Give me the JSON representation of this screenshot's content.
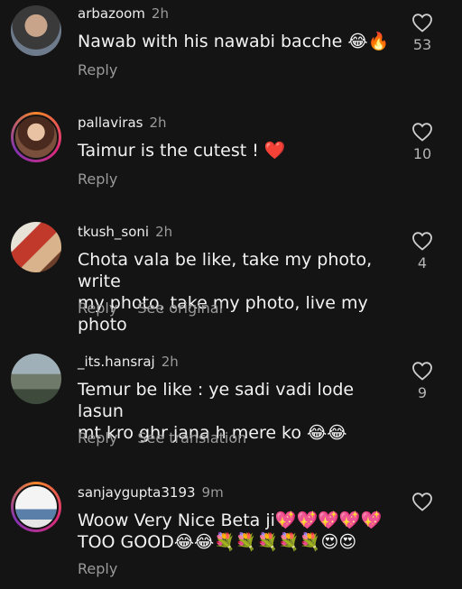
{
  "comments": [
    {
      "username": "arbazoom",
      "time": "2h",
      "lines": [
        "Nawab with his nawabi bacche 😂🔥"
      ],
      "likes": "53",
      "actions": [
        "Reply"
      ]
    },
    {
      "username": "pallaviras",
      "time": "2h",
      "lines": [
        "Taimur is the cutest ! ❤️"
      ],
      "likes": "10",
      "actions": [
        "Reply"
      ]
    },
    {
      "username": "tkush_soni",
      "time": "2h",
      "lines": [
        "Chota vala be like, take my photo, write",
        "my photo, take my photo, live my photo"
      ],
      "likes": "4",
      "actions": [
        "Reply",
        "See original"
      ]
    },
    {
      "username": "_its.hansraj",
      "time": "2h",
      "lines": [
        "Temur be like : ye sadi vadi lode lasun",
        "mt kro ghr jana h mere ko 😂😂"
      ],
      "likes": "9",
      "actions": [
        "Reply",
        "See translation"
      ]
    },
    {
      "username": "sanjaygupta3193",
      "time": "9m",
      "lines": [
        "Woow Very Nice Beta ji💖💖💖💖💖",
        "TOO GOOD😂😂💐💐💐💐💐😍😍"
      ],
      "likes": "",
      "actions": [
        "Reply"
      ]
    }
  ],
  "icons": {
    "like": "heart-outline-icon"
  },
  "colors": {
    "background": "#141414",
    "secondary_text": "#9a9a9a",
    "story_ring": "#dd2a7b"
  }
}
